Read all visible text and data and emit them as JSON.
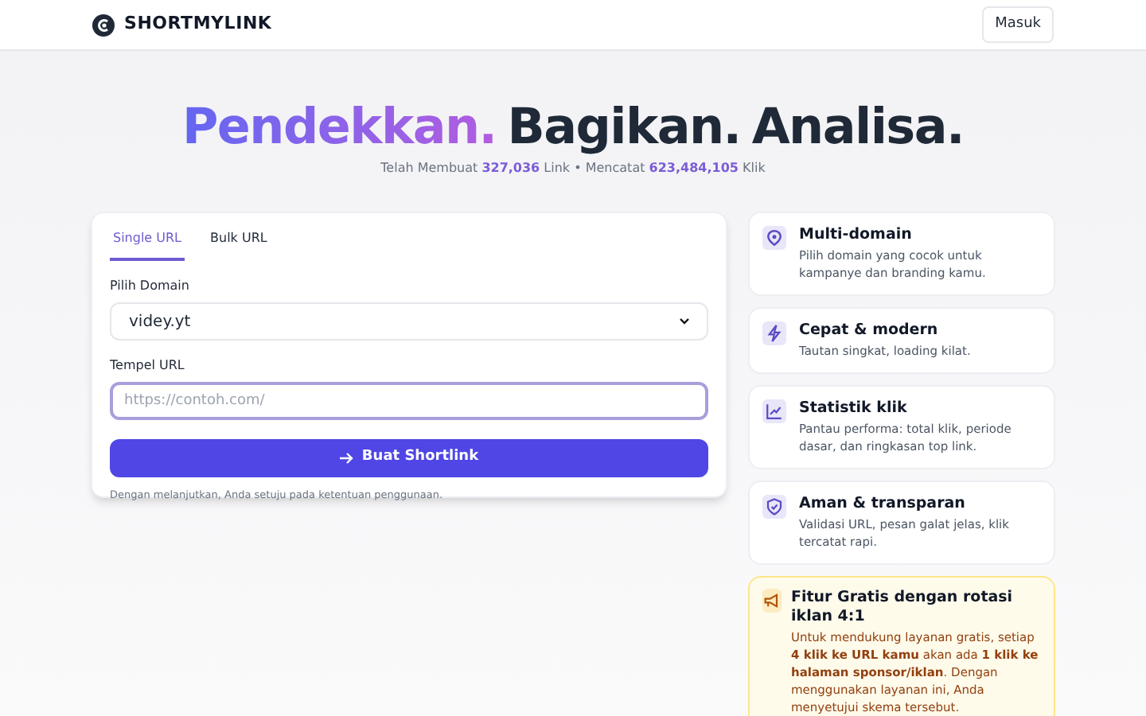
{
  "header": {
    "brand": "SHORTMYLINK",
    "login_button": "Masuk"
  },
  "hero": {
    "title_parts": [
      {
        "text": "Pendekkan.",
        "kind": "gradient"
      },
      {
        "text": "Bagikan.",
        "kind": "plain"
      },
      {
        "text": "Analisa.",
        "kind": "plain"
      }
    ],
    "stats": "Telah Membuat **327,036** Link • Mencatat **623,484,105** Klik"
  },
  "form": {
    "tabs": [
      {
        "label": "Single URL",
        "selected": true
      },
      {
        "label": "Bulk URL",
        "selected": false
      }
    ],
    "domain_label": "Pilih Domain",
    "domain_value": "videy.yt",
    "url_label": "Tempel URL",
    "url_placeholder": "https://contoh.com/",
    "submit_button": "Buat Shortlink",
    "footnote": "Dengan melanjutkan, Anda setuju pada ketentuan penggunaan."
  },
  "features": [
    {
      "kind": "domain",
      "title": "Multi-domain",
      "text": "Pilih domain yang cocok untuk kampanye dan branding kamu."
    },
    {
      "kind": "speed",
      "title": "Cepat & modern",
      "text": "Tautan singkat, loading kilat."
    },
    {
      "kind": "stats",
      "title": "Statistik klik",
      "text": "Pantau performa: total klik, periode dasar, dan ringkasan top link."
    },
    {
      "kind": "secure",
      "title": "Aman & transparan",
      "text": "Validasi URL, pesan galat jelas, klik tercatat rapi."
    }
  ],
  "notice": {
    "title": "Fitur Gratis dengan rotasi iklan 4:1",
    "text": "Untuk mendukung layanan gratis, setiap **4 klik ke URL kamu** akan ada **1 klik ke halaman sponsor/iklan**. Dengan menggunakan layanan ini, Anda menyetujui skema tersebut."
  }
}
